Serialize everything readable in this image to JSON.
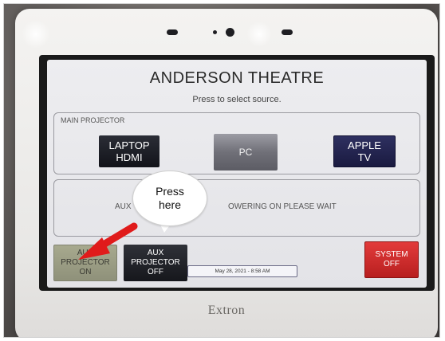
{
  "panel": {
    "title": "ANDERSON THEATRE",
    "subtitle": "Press to select source.",
    "main_group_label": "MAIN PROJECTOR",
    "sources": [
      {
        "line1": "LAPTOP",
        "line2": "HDMI"
      },
      {
        "line1": "PC",
        "line2": ""
      },
      {
        "line1": "APPLE",
        "line2": "TV"
      }
    ],
    "aux_status_left": "AUX",
    "aux_status_right": "OWERING ON PLEASE WAIT",
    "aux_on": {
      "line1": "AUX",
      "line2": "PROJECTOR",
      "line3": "ON"
    },
    "aux_off": {
      "line1": "AUX",
      "line2": "PROJECTOR",
      "line3": "OFF"
    },
    "datetime": "May 28, 2021  -  8:58 AM",
    "system_off": {
      "line1": "SYSTEM",
      "line2": "OFF"
    }
  },
  "device": {
    "brand": "Extron"
  },
  "annotation": {
    "callout_line1": "Press",
    "callout_line2": "here",
    "arrow_color": "#e01b1b"
  }
}
